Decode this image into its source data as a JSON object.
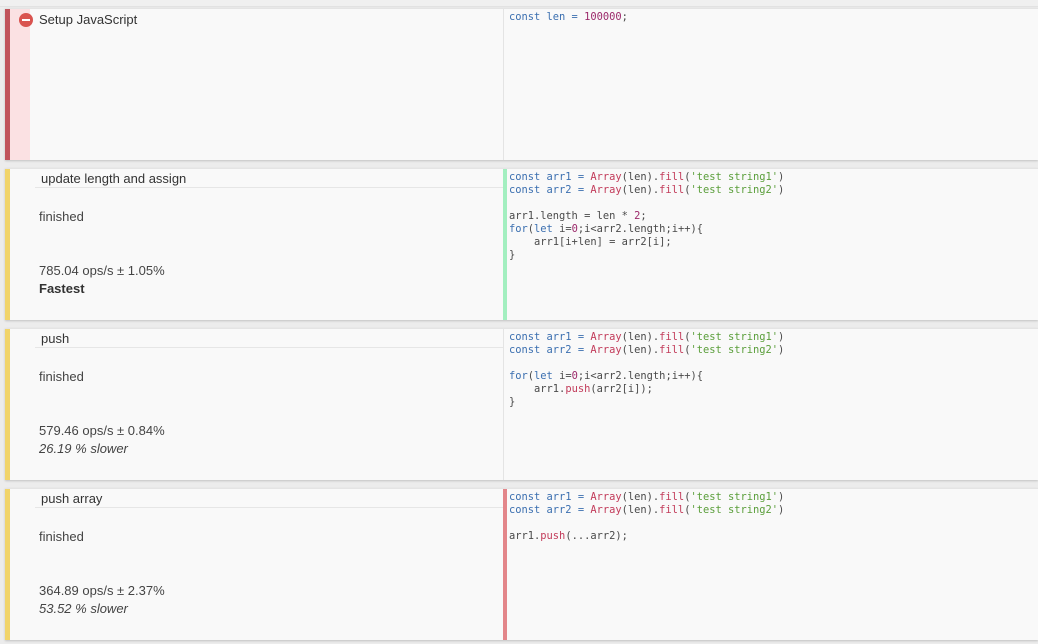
{
  "setup": {
    "title": "Setup JavaScript",
    "code": [
      [
        {
          "t": "const len = ",
          "c": "kw"
        },
        {
          "t": "100000",
          "c": "num"
        },
        {
          "t": ";",
          "c": "plain"
        }
      ]
    ]
  },
  "tests": [
    {
      "title": "update length and assign",
      "status": "finished",
      "ops": "785.04 ops/s ± 1.05%",
      "note": "Fastest",
      "note_style": "fast",
      "stripe_color": "#f1d46a",
      "code_stripe_color": "#a3efc0",
      "code": [
        [
          {
            "t": "const arr1 = ",
            "c": "kw"
          },
          {
            "t": "Array",
            "c": "fn"
          },
          {
            "t": "(len).",
            "c": "plain"
          },
          {
            "t": "fill",
            "c": "fn"
          },
          {
            "t": "(",
            "c": "plain"
          },
          {
            "t": "'test string1'",
            "c": "str"
          },
          {
            "t": ")",
            "c": "plain"
          }
        ],
        [
          {
            "t": "const arr2 = ",
            "c": "kw"
          },
          {
            "t": "Array",
            "c": "fn"
          },
          {
            "t": "(len).",
            "c": "plain"
          },
          {
            "t": "fill",
            "c": "fn"
          },
          {
            "t": "(",
            "c": "plain"
          },
          {
            "t": "'test string2'",
            "c": "str"
          },
          {
            "t": ")",
            "c": "plain"
          }
        ],
        [],
        [
          {
            "t": "arr1.length = len * ",
            "c": "plain"
          },
          {
            "t": "2",
            "c": "num"
          },
          {
            "t": ";",
            "c": "plain"
          }
        ],
        [
          {
            "t": "for",
            "c": "kw"
          },
          {
            "t": "(",
            "c": "plain"
          },
          {
            "t": "let ",
            "c": "kw"
          },
          {
            "t": "i=",
            "c": "plain"
          },
          {
            "t": "0",
            "c": "num"
          },
          {
            "t": ";i<arr2.length;i++){",
            "c": "plain"
          }
        ],
        [
          {
            "t": "    arr1[i+len] = arr2[i];",
            "c": "plain"
          }
        ],
        [
          {
            "t": "}",
            "c": "plain"
          }
        ]
      ]
    },
    {
      "title": "push",
      "status": "finished",
      "ops": "579.46 ops/s ± 0.84%",
      "note": "26.19 % slower",
      "note_style": "slow",
      "stripe_color": "#f1d46a",
      "code_stripe_color": "",
      "code": [
        [
          {
            "t": "const arr1 = ",
            "c": "kw"
          },
          {
            "t": "Array",
            "c": "fn"
          },
          {
            "t": "(len).",
            "c": "plain"
          },
          {
            "t": "fill",
            "c": "fn"
          },
          {
            "t": "(",
            "c": "plain"
          },
          {
            "t": "'test string1'",
            "c": "str"
          },
          {
            "t": ")",
            "c": "plain"
          }
        ],
        [
          {
            "t": "const arr2 = ",
            "c": "kw"
          },
          {
            "t": "Array",
            "c": "fn"
          },
          {
            "t": "(len).",
            "c": "plain"
          },
          {
            "t": "fill",
            "c": "fn"
          },
          {
            "t": "(",
            "c": "plain"
          },
          {
            "t": "'test string2'",
            "c": "str"
          },
          {
            "t": ")",
            "c": "plain"
          }
        ],
        [],
        [
          {
            "t": "for",
            "c": "kw"
          },
          {
            "t": "(",
            "c": "plain"
          },
          {
            "t": "let ",
            "c": "kw"
          },
          {
            "t": "i=",
            "c": "plain"
          },
          {
            "t": "0",
            "c": "num"
          },
          {
            "t": ";i<arr2.length;i++){",
            "c": "plain"
          }
        ],
        [
          {
            "t": "    arr1.",
            "c": "plain"
          },
          {
            "t": "push",
            "c": "fn"
          },
          {
            "t": "(arr2[i]);",
            "c": "plain"
          }
        ],
        [
          {
            "t": "}",
            "c": "plain"
          }
        ]
      ]
    },
    {
      "title": "push array",
      "status": "finished",
      "ops": "364.89 ops/s ± 2.37%",
      "note": "53.52 % slower",
      "note_style": "slow",
      "stripe_color": "#f1d46a",
      "code_stripe_color": "#e3868a",
      "code": [
        [
          {
            "t": "const arr1 = ",
            "c": "kw"
          },
          {
            "t": "Array",
            "c": "fn"
          },
          {
            "t": "(len).",
            "c": "plain"
          },
          {
            "t": "fill",
            "c": "fn"
          },
          {
            "t": "(",
            "c": "plain"
          },
          {
            "t": "'test string1'",
            "c": "str"
          },
          {
            "t": ")",
            "c": "plain"
          }
        ],
        [
          {
            "t": "const arr2 = ",
            "c": "kw"
          },
          {
            "t": "Array",
            "c": "fn"
          },
          {
            "t": "(len).",
            "c": "plain"
          },
          {
            "t": "fill",
            "c": "fn"
          },
          {
            "t": "(",
            "c": "plain"
          },
          {
            "t": "'test string2'",
            "c": "str"
          },
          {
            "t": ")",
            "c": "plain"
          }
        ],
        [],
        [
          {
            "t": "arr1.",
            "c": "plain"
          },
          {
            "t": "push",
            "c": "fn"
          },
          {
            "t": "(...arr2);",
            "c": "plain"
          }
        ]
      ]
    }
  ],
  "colors": {
    "setup_stripe": "#c0545b"
  }
}
